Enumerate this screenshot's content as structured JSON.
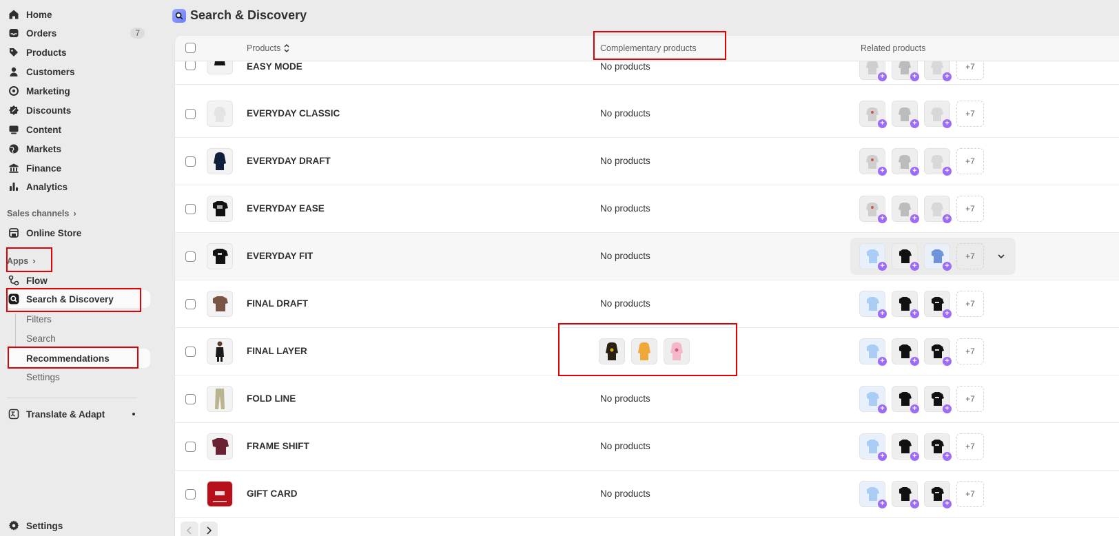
{
  "sidebar": {
    "items": [
      {
        "label": "Home",
        "icon": "home-icon"
      },
      {
        "label": "Orders",
        "icon": "inbox-icon",
        "badge": "7"
      },
      {
        "label": "Products",
        "icon": "tag-icon"
      },
      {
        "label": "Customers",
        "icon": "person-icon"
      },
      {
        "label": "Marketing",
        "icon": "target-icon"
      },
      {
        "label": "Discounts",
        "icon": "discount-icon"
      },
      {
        "label": "Content",
        "icon": "content-icon"
      },
      {
        "label": "Markets",
        "icon": "globe-icon"
      },
      {
        "label": "Finance",
        "icon": "bank-icon"
      },
      {
        "label": "Analytics",
        "icon": "bar-chart-icon"
      }
    ],
    "sales_channels_label": "Sales channels",
    "online_store_label": "Online Store",
    "apps_label": "Apps",
    "flow_label": "Flow",
    "search_discovery_label": "Search & Discovery",
    "sub_items": [
      "Filters",
      "Search",
      "Recommendations",
      "Settings"
    ],
    "translate_label": "Translate & Adapt",
    "settings_label": "Settings"
  },
  "header": {
    "title": "Search & Discovery"
  },
  "table": {
    "columns": {
      "products": "Products",
      "complementary": "Complementary products",
      "related": "Related products"
    },
    "more_label": "+7",
    "rows": [
      {
        "name": "EASY MODE",
        "complementary": "No products"
      },
      {
        "name": "EVERYDAY CLASSIC",
        "complementary": "No products"
      },
      {
        "name": "EVERYDAY DRAFT",
        "complementary": "No products"
      },
      {
        "name": "EVERYDAY EASE",
        "complementary": "No products"
      },
      {
        "name": "EVERYDAY FIT",
        "complementary": "No products"
      },
      {
        "name": "FINAL DRAFT",
        "complementary": "No products"
      },
      {
        "name": "FINAL LAYER",
        "complementary": ""
      },
      {
        "name": "FOLD LINE",
        "complementary": "No products"
      },
      {
        "name": "FRAME SHIFT",
        "complementary": "No products"
      },
      {
        "name": "GIFT CARD",
        "complementary": "No products"
      }
    ]
  },
  "colors": {
    "highlight": "#e20000",
    "accent_purple": "#9c6bf7"
  }
}
